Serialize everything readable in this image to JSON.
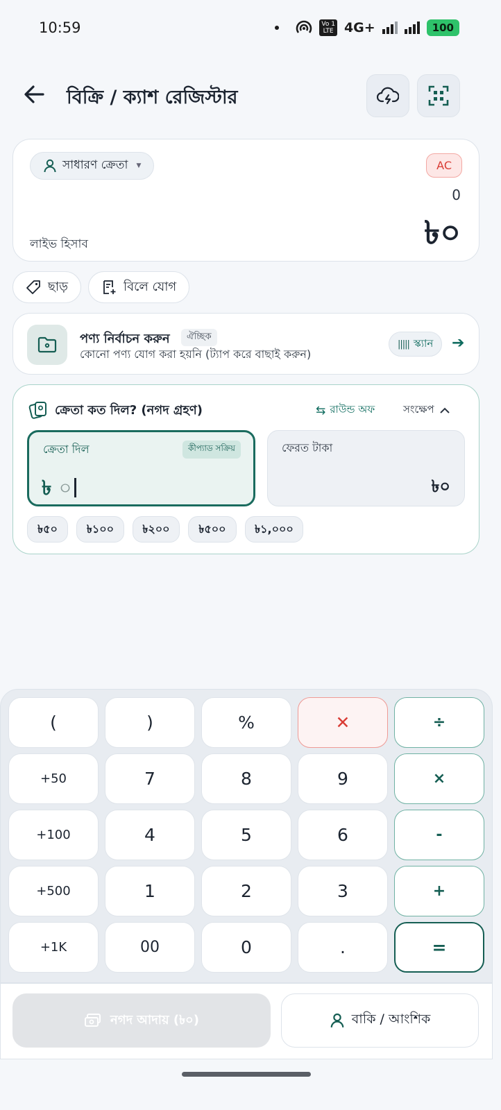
{
  "status": {
    "time": "10:59",
    "network": "4G+",
    "volte_top": "Vo",
    "volte_bottom": "LTE",
    "sim": "1",
    "battery": "100"
  },
  "header": {
    "title": "বিক্রি / ক্যাশ রেজিস্টার",
    "back_icon": "arrow-left-icon",
    "cloud_icon": "cloud-sync-icon",
    "scan_icon": "qr-scan-icon"
  },
  "customer": {
    "name": "সাধারণ ক্রেতা",
    "ac_badge": "AC",
    "item_count": "0",
    "total": "৳০",
    "live_label": "লাইভ হিসাব"
  },
  "actions": {
    "discount": "ছাড়",
    "add_to_bill": "বিলে যোগ"
  },
  "product": {
    "title": "পণ্য নির্বাচন করুন",
    "optional": "ঐচ্ছিক",
    "subtitle": "কোনো পণ্য যোগ করা হয়নি (ট্যাপ করে বাছাই করুন)",
    "scan_label": "স্ক্যান",
    "scan_glyph": "|||||",
    "arrow": "➔"
  },
  "payment": {
    "title": "ক্রেতা কত দিল? (নগদ গ্রহণ)",
    "round_off": "রাউন্ড অফ",
    "collapse": "সংক্ষেপ",
    "given_label": "ক্রেতা দিল",
    "keypad_active": "কীপ্যাড সক্রিয়",
    "given_currency": "৳",
    "given_value": "০",
    "change_label": "ফেরত টাকা",
    "change_value": "৳০",
    "quick_amounts": [
      "৳৫০",
      "৳১০০",
      "৳২০০",
      "৳৫০০",
      "৳১,০০০"
    ]
  },
  "keypad": {
    "rows": [
      [
        "(",
        ")",
        "%",
        "✕",
        "÷"
      ],
      [
        "+50",
        "7",
        "8",
        "9",
        "×"
      ],
      [
        "+100",
        "4",
        "5",
        "6",
        "-"
      ],
      [
        "+500",
        "1",
        "2",
        "3",
        "+"
      ],
      [
        "+1K",
        "00",
        "0",
        ".",
        "="
      ]
    ]
  },
  "bottom": {
    "cash_collect": "নগদ আদায় (৳০)",
    "due_partial": "বাকি / আংশিক"
  },
  "colors": {
    "accent": "#155e53",
    "danger": "#d93c35",
    "battery": "#2ec26a"
  }
}
